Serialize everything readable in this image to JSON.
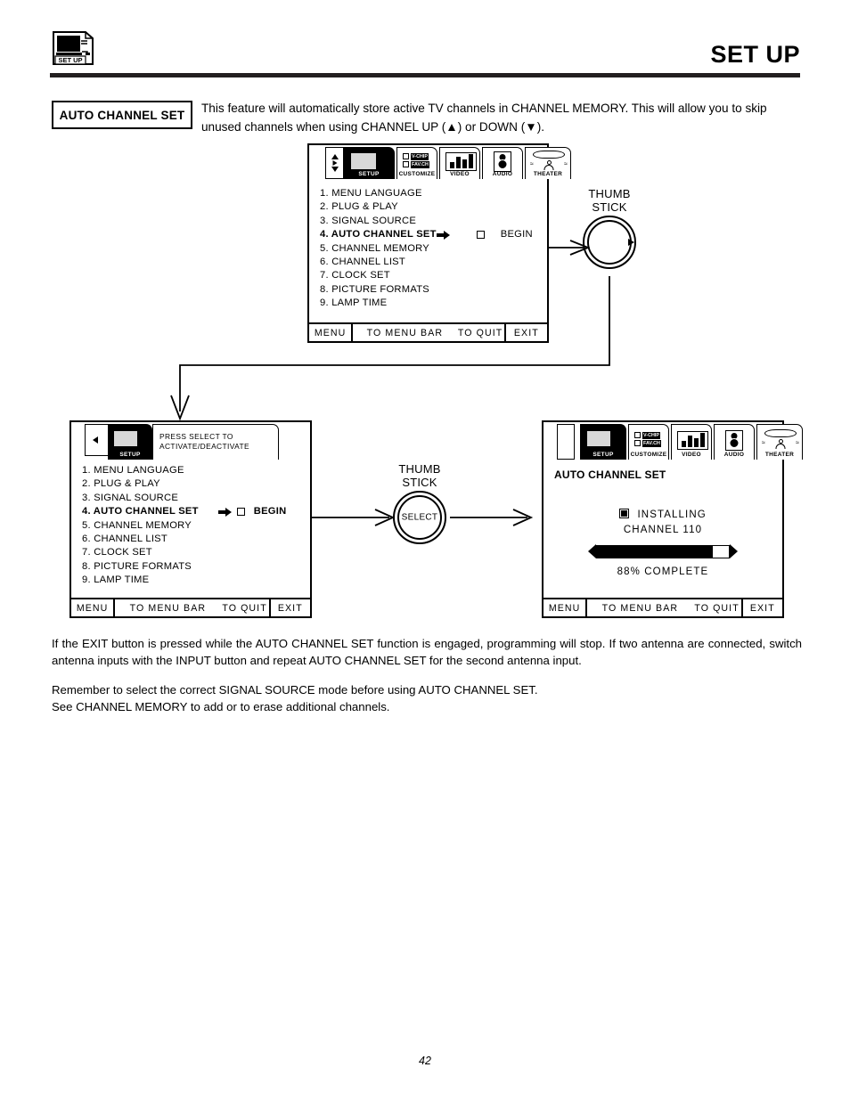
{
  "header": {
    "icon_label": "SET UP",
    "title": "SET UP"
  },
  "intro": {
    "badge": "AUTO CHANNEL SET",
    "text": "This feature will automatically store active TV channels in CHANNEL MEMORY.  This will allow you to skip unused channels when using CHANNEL UP (▲) or DOWN (▼)."
  },
  "menu_tabs": [
    {
      "label": "SETUP",
      "icon": "tv-screen-icon",
      "selected": true
    },
    {
      "label": "CUSTOMIZE",
      "icon": "vchip-favch-icon",
      "selected": false
    },
    {
      "label": "VIDEO",
      "icon": "video-bars-icon",
      "selected": false
    },
    {
      "label": "AUDIO",
      "icon": "speaker-icon",
      "selected": false
    },
    {
      "label": "THEATER",
      "icon": "theater-screen-icon",
      "selected": false
    }
  ],
  "customize_icon": {
    "line1": "V-CHIP",
    "line2": "FAV.CH"
  },
  "menu_items": [
    "1. MENU LANGUAGE",
    "2. PLUG & PLAY",
    "3. SIGNAL SOURCE",
    "4. AUTO CHANNEL SET",
    "5. CHANNEL MEMORY",
    "6. CHANNEL LIST",
    "7. CLOCK SET",
    "8. PICTURE FORMATS",
    "9. LAMP TIME"
  ],
  "active_item_index": 3,
  "begin_label": "BEGIN",
  "osd_footer": {
    "menu": "MENU",
    "to_menu_bar": "TO MENU BAR",
    "to_quit": "TO QUIT",
    "exit": "EXIT"
  },
  "thumbstick_top": {
    "label": "THUMB\nSTICK"
  },
  "thumbstick_mid": {
    "label": "THUMB\nSTICK",
    "button": "SELECT"
  },
  "panel2": {
    "banner_line1": "PRESS SELECT TO",
    "banner_line2": "ACTIVATE/DEACTIVATE",
    "tab_label": "SETUP"
  },
  "panel3": {
    "title": "AUTO CHANNEL SET",
    "installing": "INSTALLING",
    "channel": "CHANNEL 110",
    "percent_text": "88% COMPLETE",
    "percent_value": 88
  },
  "notes": {
    "note1": "If the EXIT button is pressed while the AUTO CHANNEL SET function is engaged, programming will stop.  If two antenna are connected, switch antenna inputs with the INPUT button and repeat AUTO CHANNEL SET for the second antenna input.",
    "note2_line1": "Remember to select the correct SIGNAL SOURCE mode before using AUTO CHANNEL SET.",
    "note2_line2": "See CHANNEL MEMORY to add or to erase additional channels."
  },
  "page_number": "42",
  "colors": {
    "ink": "#000000",
    "rule": "#231f20",
    "screen_fill": "#d8d8d8",
    "background": "#ffffff"
  }
}
